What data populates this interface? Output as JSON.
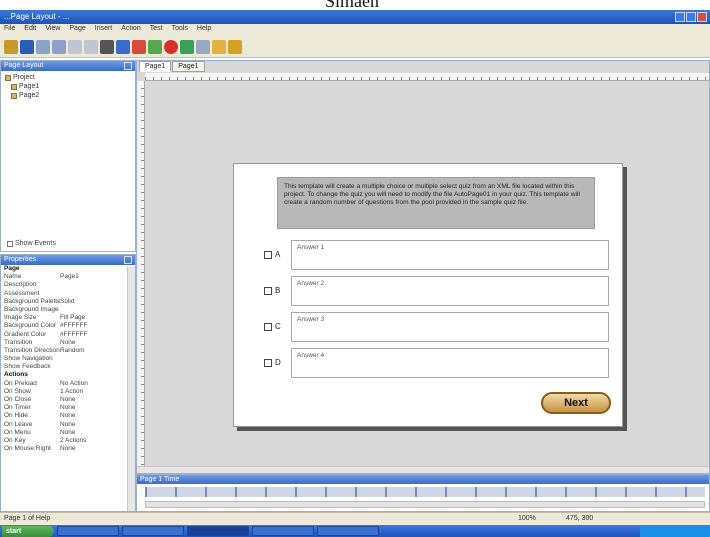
{
  "colors": {
    "accent": "#1d54b8",
    "next_button": "#c89242",
    "instructions_bg": "#b8b8b8",
    "canvas_bg": "#d8d8d8"
  },
  "top_text": "Simaen",
  "window": {
    "title": "...Page Layout - ...",
    "buttons": [
      "minimize",
      "maximize",
      "close"
    ]
  },
  "menu": [
    "File",
    "Edit",
    "View",
    "Page",
    "Insert",
    "Action",
    "Test",
    "Tools",
    "Help"
  ],
  "toolbar_icons": [
    {
      "name": "open-icon",
      "color": "#c89a2a"
    },
    {
      "name": "save-icon",
      "color": "#2b5cb8"
    },
    {
      "name": "undo-icon",
      "color": "#8aa2c8"
    },
    {
      "name": "redo-icon",
      "color": "#8aa2c8"
    },
    {
      "name": "copy-icon",
      "color": "#bfc6d2"
    },
    {
      "name": "paste-icon",
      "color": "#bfc6d2"
    },
    {
      "name": "text-icon",
      "color": "#555555"
    },
    {
      "name": "image-icon",
      "color": "#3a6cc9"
    },
    {
      "name": "shape-icon",
      "color": "#d84b3a"
    },
    {
      "name": "button-icon",
      "color": "#56a84a"
    },
    {
      "name": "record-icon",
      "color": "#d8302a"
    },
    {
      "name": "media-icon",
      "color": "#3aa05a"
    },
    {
      "name": "zoom-icon",
      "color": "#98a8c0"
    },
    {
      "name": "preview-icon",
      "color": "#e0b040"
    },
    {
      "name": "publish-icon",
      "color": "#d8a020"
    }
  ],
  "left_panel": {
    "header": "Page Layout",
    "tree": [
      {
        "label": "Project"
      },
      {
        "label": "Page1"
      },
      {
        "label": "Page2"
      }
    ],
    "show_events": "Show Events"
  },
  "properties": {
    "header": "Properties",
    "rows": [
      {
        "key": "Page",
        "value": "",
        "section": true
      },
      {
        "key": "Name",
        "value": "Page1"
      },
      {
        "key": "Description",
        "value": ""
      },
      {
        "key": "Assessment",
        "value": ""
      },
      {
        "key": "Background Palette",
        "value": "Solid"
      },
      {
        "key": "Background Image",
        "value": ""
      },
      {
        "key": "Image Size",
        "value": "Fill Page"
      },
      {
        "key": "Background Color",
        "value": "#FFFFFF"
      },
      {
        "key": "Gradient Color",
        "value": "#FFFFFF"
      },
      {
        "key": "Transition",
        "value": "None"
      },
      {
        "key": "Transition Direction",
        "value": "Random"
      },
      {
        "key": "Show Navigation",
        "value": ""
      },
      {
        "key": "Show Feedback",
        "value": ""
      },
      {
        "key": "Actions",
        "value": "",
        "section": true
      },
      {
        "key": "On Preload",
        "value": "No Action"
      },
      {
        "key": "On Show",
        "value": "1 Action"
      },
      {
        "key": "On Close",
        "value": "None"
      },
      {
        "key": "On Timer",
        "value": "None"
      },
      {
        "key": "On Hide",
        "value": "None"
      },
      {
        "key": "On Leave",
        "value": "None"
      },
      {
        "key": "On Menu",
        "value": "None"
      },
      {
        "key": "On Key",
        "value": "2 Actions"
      },
      {
        "key": "On Mouse Right",
        "value": "None"
      }
    ]
  },
  "tabs": [
    {
      "label": "Page1",
      "active": true
    },
    {
      "label": "Page1",
      "active": false
    }
  ],
  "card": {
    "instructions": "This template will create a multiple choice or multiple select quiz from an XML file located within this project. To change the quiz you will need to modify the file AutoPage01 in your quiz. This template will create a random number of questions from the pool provided in the sample quiz file.",
    "answers": [
      {
        "letter": "A",
        "text": "Answer 1"
      },
      {
        "letter": "B",
        "text": "Answer 2"
      },
      {
        "letter": "C",
        "text": "Answer 3"
      },
      {
        "letter": "D",
        "text": "Answer 4"
      }
    ],
    "next_button": "Next"
  },
  "timeline": {
    "header": "Page 1 Time"
  },
  "statusbar": {
    "left": "Page 1 of Help",
    "zoom": "100%",
    "coords": "475, 300"
  },
  "taskbar": {
    "start": "start"
  }
}
